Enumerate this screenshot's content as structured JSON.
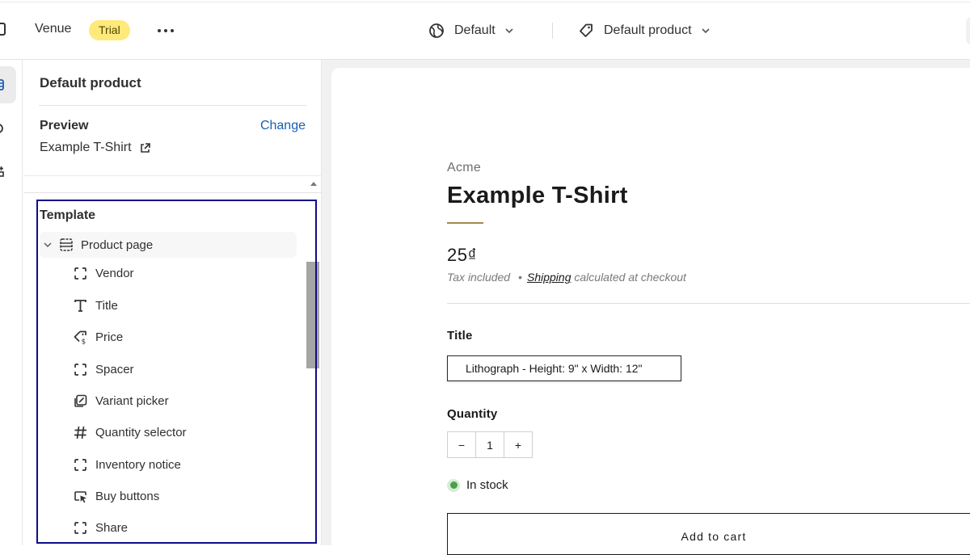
{
  "topbar": {
    "store_name": "Venue",
    "badge": "Trial",
    "theme_select": {
      "label": "Default",
      "icon": "globe-icon"
    },
    "template_select": {
      "label": "Default product",
      "icon": "tag-icon"
    }
  },
  "sidebar": {
    "title": "Default product",
    "preview": {
      "label": "Preview",
      "change_label": "Change",
      "product": "Example T-Shirt"
    },
    "template": {
      "label": "Template",
      "root": "Product page",
      "blocks": [
        {
          "label": "Vendor",
          "icon": "block-icon"
        },
        {
          "label": "Title",
          "icon": "text-icon"
        },
        {
          "label": "Price",
          "icon": "price-tag-icon"
        },
        {
          "label": "Spacer",
          "icon": "block-icon"
        },
        {
          "label": "Variant picker",
          "icon": "variant-icon"
        },
        {
          "label": "Quantity selector",
          "icon": "hash-icon"
        },
        {
          "label": "Inventory notice",
          "icon": "block-icon"
        },
        {
          "label": "Buy buttons",
          "icon": "cursor-icon"
        },
        {
          "label": "Share",
          "icon": "block-icon"
        }
      ]
    }
  },
  "product": {
    "vendor": "Acme",
    "title": "Example T-Shirt",
    "price": "25₫",
    "tax_note": "Tax included",
    "shipping_link": "Shipping",
    "shipping_note": "calculated at checkout",
    "option_label": "Title",
    "variant": "Lithograph - Height: 9\" x Width: 12\"",
    "quantity_label": "Quantity",
    "qty_minus": "−",
    "quantity": "1",
    "qty_plus": "+",
    "stock": "In stock",
    "add_to_cart": "Add to cart"
  },
  "colors": {
    "trial_badge": "#ffe97a",
    "accent_rule": "#a4894c",
    "link": "#1a5fb4",
    "selection_box": "#0d0d8a",
    "in_stock": "#4ba04b"
  }
}
